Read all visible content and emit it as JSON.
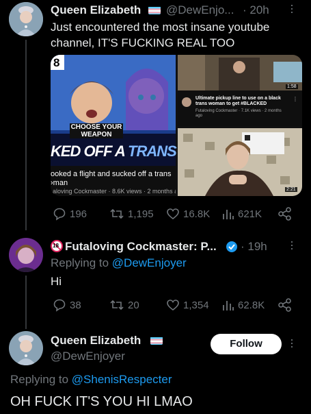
{
  "tweet1": {
    "author": "Queen Elizabeth",
    "handle": "@DewEnjo...",
    "time": "· 20h",
    "text": "Just encountered the most insane youtube channel, IT'S FUCKING REAL TOO",
    "media": {
      "left": {
        "thumb_badge": "8",
        "thumb_text_small": "CHOOSE YOUR WEAPON",
        "thumb_headline_white": "KED OFF A ",
        "thumb_headline_blue": "TRANS WO",
        "title": "ooked a flight and sucked off a trans\n›man",
        "meta": "·aloving Cockmaster · 8.6K views · 2 months a"
      },
      "right_top": {
        "duration": "1:58",
        "title": "Ultimate pickup line to use on a black trans woman to get #BLACKED",
        "meta": "Futaloving Cockmaster · 7.1K views · 2 months ago"
      },
      "right_bottom": {
        "duration": "2:21"
      }
    },
    "actions": {
      "replies": "196",
      "reposts": "1,195",
      "likes": "16.8K",
      "views": "621K"
    }
  },
  "tweet2": {
    "age_badge": "18",
    "author": "Futaloving Cockmaster: P...",
    "time": "· 19h",
    "replying_prefix": "Replying to ",
    "replying_to": "@DewEnjoyer",
    "text": "Hi",
    "actions": {
      "replies": "38",
      "reposts": "20",
      "likes": "1,354",
      "views": "62.8K"
    }
  },
  "tweet3": {
    "author": "Queen Elizabeth",
    "handle": "@DewEnjoyer",
    "follow_label": "Follow",
    "replying_prefix": "Replying to ",
    "replying_to": "@ShenisRespecter",
    "text": "OH FUCK IT'S YOU HI LMAO"
  },
  "colors": {
    "background": "#000000",
    "text": "#e7e9ea",
    "muted": "#71767b",
    "link": "#1d9bf0",
    "verified": "#1d9bf0",
    "flag_blue": "#5bcefa",
    "flag_pink": "#f5a9b8"
  }
}
